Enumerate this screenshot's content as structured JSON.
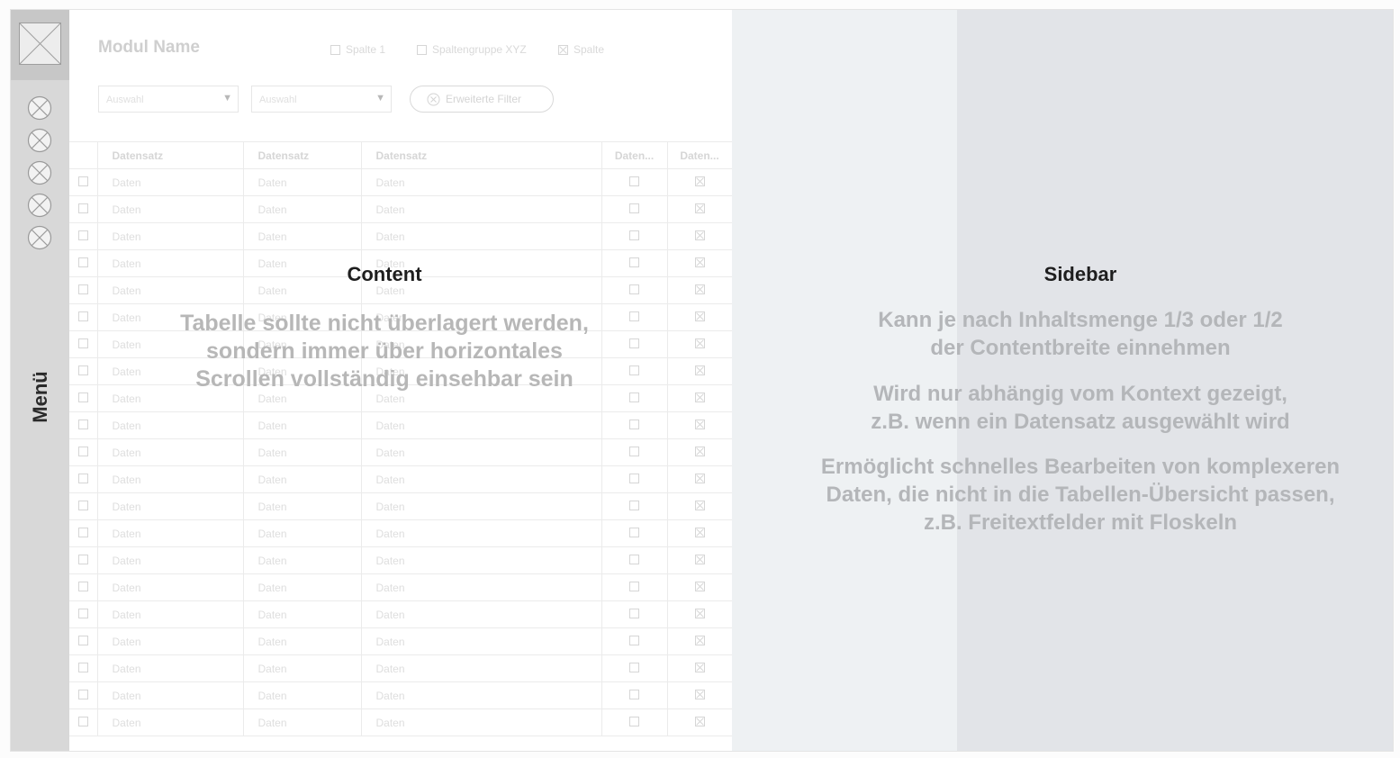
{
  "nav": {
    "menu_label": "Menü",
    "item_icons": [
      "x-circle-icon",
      "x-circle-icon",
      "x-circle-icon",
      "x-circle-icon",
      "x-circle-icon"
    ]
  },
  "module": {
    "title": "Modul Name",
    "column_toggles": [
      {
        "label": "Spalte 1",
        "checked": false
      },
      {
        "label": "Spaltengruppe XYZ",
        "checked": false
      },
      {
        "label": "Spalte",
        "checked": true
      }
    ],
    "filters": [
      {
        "placeholder": "Auswahl"
      },
      {
        "placeholder": "Auswahl"
      }
    ],
    "advanced_filter_label": "Erweiterte Filter"
  },
  "table": {
    "headers": [
      "Datensatz",
      "Datensatz",
      "Datensatz",
      "Daten...",
      "Daten..."
    ],
    "cell": "Daten",
    "row_count": 21
  },
  "content_overlay": {
    "title": "Content",
    "lines": [
      "Tabelle sollte nicht überlagert werden,",
      "sondern immer über horizontales",
      "Scrollen vollständig einsehbar sein"
    ]
  },
  "sidebar": {
    "title": "Sidebar",
    "paragraphs": [
      [
        "Kann je nach Inhaltsmenge 1/3 oder 1/2",
        "der Contentbreite einnehmen"
      ],
      [
        "Wird nur abhängig vom Kontext gezeigt,",
        "z.B. wenn ein Datensatz ausgewählt wird"
      ],
      [
        "Ermöglicht schnelles Bearbeiten von komplexeren",
        "Daten, die nicht in die Tabellen-Übersicht passen,",
        "z.B. Freitextfelder mit Floskeln"
      ]
    ]
  },
  "colors": {
    "nav_bg": "#d8d8d8",
    "sidebar_light": "#eef1f3",
    "sidebar_dark": "#e2e4e8"
  }
}
